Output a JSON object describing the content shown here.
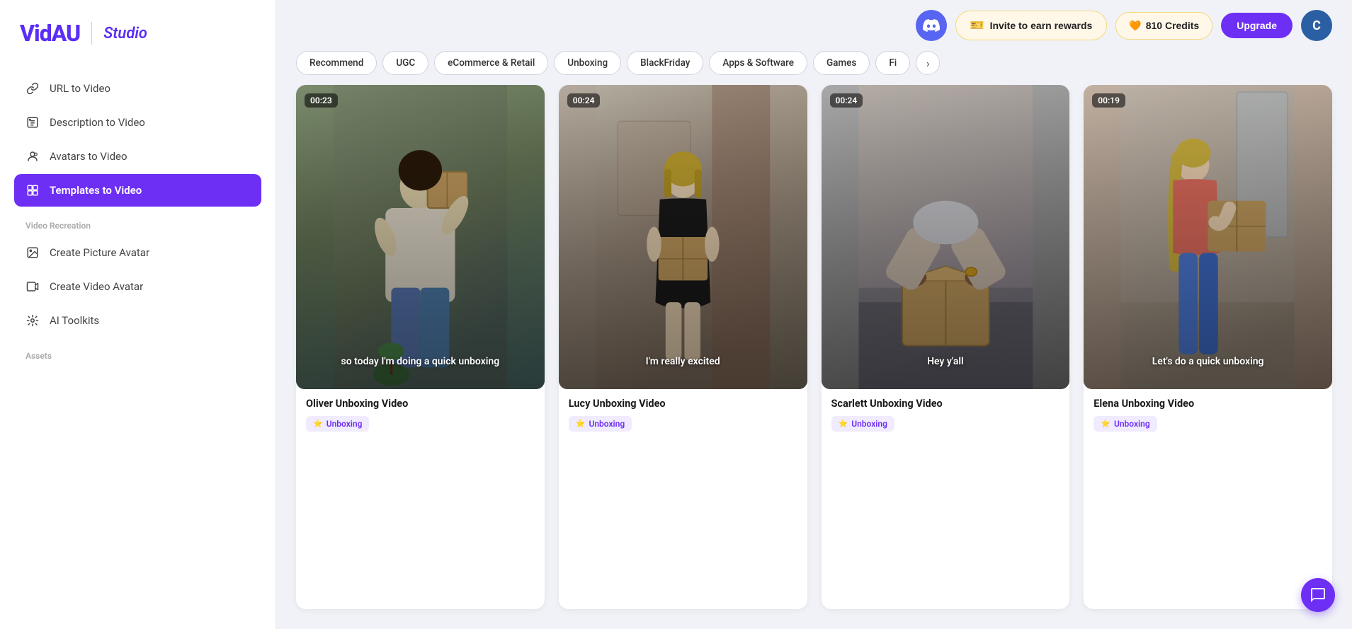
{
  "brand": {
    "logo": "VidAU",
    "divider": "|",
    "studio": "Studio"
  },
  "sidebar": {
    "section_tools": "",
    "items": [
      {
        "id": "url-to-video",
        "label": "URL to Video",
        "icon": "🔗",
        "active": false
      },
      {
        "id": "description-to-video",
        "label": "Description to Video",
        "icon": "🔒",
        "active": false
      },
      {
        "id": "avatars-to-video",
        "label": "Avatars to Video",
        "icon": "⊙",
        "active": false
      },
      {
        "id": "templates-to-video",
        "label": "Templates to Video",
        "icon": "▦",
        "active": true
      }
    ],
    "section_recreation": "Video Recreation",
    "recreation_items": [
      {
        "id": "create-picture-avatar",
        "label": "Create Picture Avatar",
        "icon": "🖼"
      },
      {
        "id": "create-video-avatar",
        "label": "Create Video Avatar",
        "icon": "▶"
      },
      {
        "id": "ai-toolkits",
        "label": "AI Toolkits",
        "icon": "✳"
      }
    ],
    "section_assets": "Assets"
  },
  "topbar": {
    "invite_label": "Invite to earn rewards",
    "credits_label": "810 Credits",
    "upgrade_label": "Upgrade",
    "avatar_letter": "C"
  },
  "filters": {
    "chips": [
      {
        "id": "recommend",
        "label": "Recommend",
        "active": false
      },
      {
        "id": "ugc",
        "label": "UGC",
        "active": false
      },
      {
        "id": "ecommerce",
        "label": "eCommerce & Retail",
        "active": false
      },
      {
        "id": "unboxing",
        "label": "Unboxing",
        "active": false
      },
      {
        "id": "blackfriday",
        "label": "BlackFriday",
        "active": false
      },
      {
        "id": "apps-software",
        "label": "Apps & Software",
        "active": false
      },
      {
        "id": "games",
        "label": "Games",
        "active": false
      },
      {
        "id": "fi",
        "label": "Fi",
        "active": false
      }
    ],
    "arrow": "›"
  },
  "videos": [
    {
      "id": "oliver",
      "title": "Oliver Unboxing Video",
      "duration": "00:23",
      "caption": "so today I'm doing a quick unboxing",
      "tag": "Unboxing",
      "bg": "oliver"
    },
    {
      "id": "lucy",
      "title": "Lucy Unboxing Video",
      "duration": "00:24",
      "caption": "I'm really excited",
      "tag": "Unboxing",
      "bg": "lucy"
    },
    {
      "id": "scarlett",
      "title": "Scarlett Unboxing Video",
      "duration": "00:24",
      "caption": "Hey y'all",
      "tag": "Unboxing",
      "bg": "scarlett"
    },
    {
      "id": "elena",
      "title": "Elena Unboxing Video",
      "duration": "00:19",
      "caption": "Let's do a quick unboxing",
      "tag": "Unboxing",
      "bg": "elena"
    }
  ],
  "colors": {
    "accent": "#6e2ff5",
    "discord": "#5865F2",
    "credits_bg": "#fff8e8",
    "tag_bg": "#f0ebff",
    "tag_text": "#6e2ff5"
  }
}
